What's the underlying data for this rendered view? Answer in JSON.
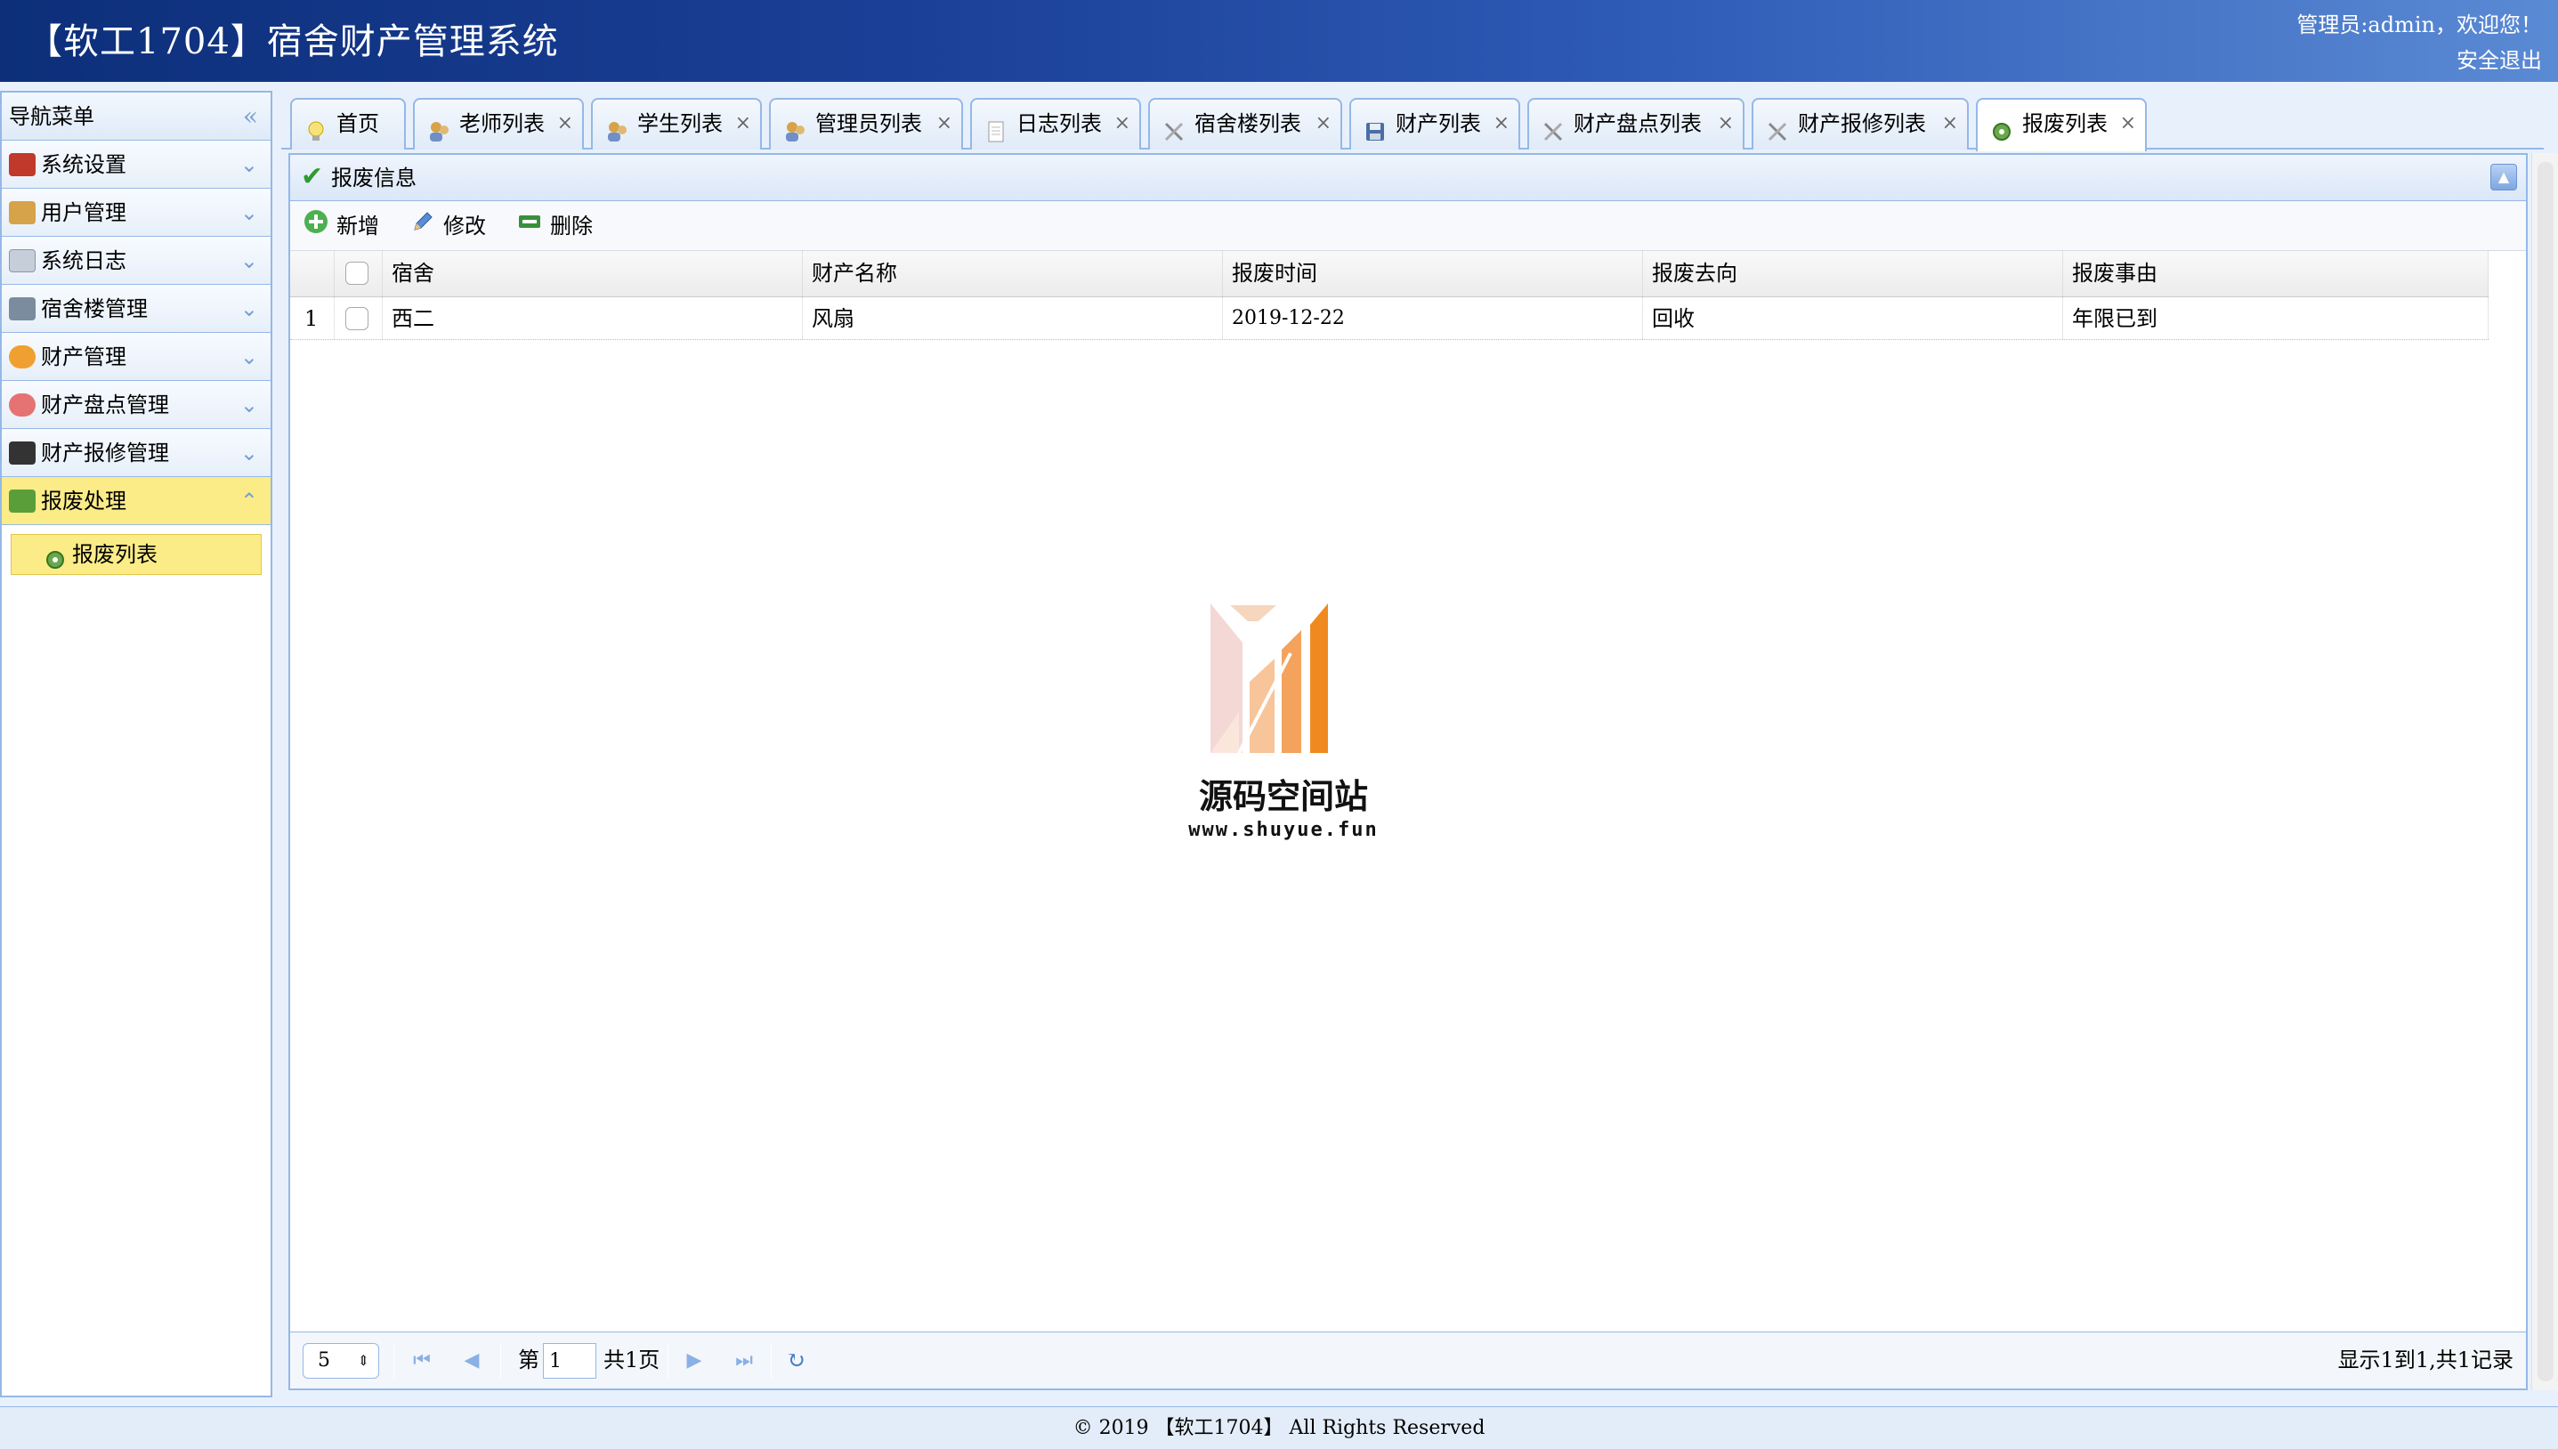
{
  "header": {
    "title": "【软工1704】宿舍财产管理系统",
    "user": "管理员:admin，欢迎您！",
    "logout": "安全退出"
  },
  "sidebar": {
    "title": "导航菜单",
    "collapse": "«",
    "items": [
      {
        "label": "系统设置",
        "icon": "tools-icon",
        "color": "#c0392b"
      },
      {
        "label": "用户管理",
        "icon": "users-icon",
        "color": "#d6a24a"
      },
      {
        "label": "系统日志",
        "icon": "log-icon",
        "color": "#9aa6b6"
      },
      {
        "label": "宿舍楼管理",
        "icon": "building-icon",
        "color": "#7a8c9e"
      },
      {
        "label": "财产管理",
        "icon": "gear-icon",
        "color": "#f0a030"
      },
      {
        "label": "财产盘点管理",
        "icon": "flower-icon",
        "color": "#e57373"
      },
      {
        "label": "财产报修管理",
        "icon": "terminal-icon",
        "color": "#333333"
      },
      {
        "label": "报废处理",
        "icon": "basket-icon",
        "color": "#5a9e3a"
      }
    ],
    "sub_items": [
      {
        "label": "报废列表",
        "icon": "scrap-gear-icon"
      }
    ]
  },
  "tabs": [
    {
      "label": "首页",
      "closable": false,
      "icon": "bulb-icon"
    },
    {
      "label": "老师列表",
      "closable": true,
      "icon": "users-icon"
    },
    {
      "label": "学生列表",
      "closable": true,
      "icon": "users-icon"
    },
    {
      "label": "管理员列表",
      "closable": true,
      "icon": "users-icon"
    },
    {
      "label": "日志列表",
      "closable": true,
      "icon": "document-icon"
    },
    {
      "label": "宿舍楼列表",
      "closable": true,
      "icon": "tools-icon"
    },
    {
      "label": "财产列表",
      "closable": true,
      "icon": "save-icon"
    },
    {
      "label": "财产盘点列表",
      "closable": true,
      "icon": "tools-icon"
    },
    {
      "label": "财产报修列表",
      "closable": true,
      "icon": "tools-icon"
    },
    {
      "label": "报废列表",
      "closable": true,
      "icon": "scrap-gear-icon",
      "active": true
    }
  ],
  "tab_close": "×",
  "panel": {
    "title": "报废信息",
    "collapse": "▲"
  },
  "toolbar": {
    "add": "新增",
    "edit": "修改",
    "delete": "删除"
  },
  "grid": {
    "columns": [
      "宿舍",
      "财产名称",
      "报废时间",
      "报废去向",
      "报废事由"
    ],
    "rows": [
      {
        "num": "1",
        "dorm": "西二",
        "name": "风扇",
        "time": "2019-12-22",
        "direction": "回收",
        "reason": "年限已到"
      }
    ]
  },
  "watermark": {
    "text": "源码空间站",
    "url": "www.shuyue.fun"
  },
  "pager": {
    "page_size": "5",
    "page_prefix": "第",
    "page_value": "1",
    "page_total": "共1页",
    "summary": "显示1到1,共1记录"
  },
  "footer": "© 2019 【软工1704】 All Rights Reserved"
}
